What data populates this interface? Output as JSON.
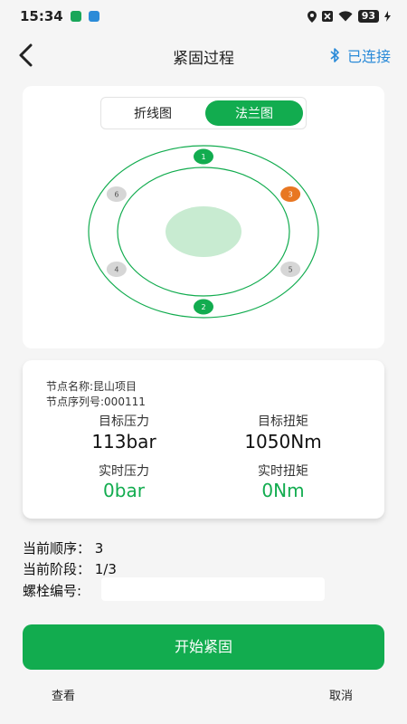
{
  "status_bar": {
    "time": "15:34",
    "battery": "93"
  },
  "header": {
    "title": "紧固过程",
    "connection": "已连接"
  },
  "tabs": [
    {
      "label": "折线图",
      "active": false
    },
    {
      "label": "法兰图",
      "active": true
    }
  ],
  "flange": {
    "bolts": [
      {
        "label": "1",
        "state": "done"
      },
      {
        "label": "3",
        "state": "current"
      },
      {
        "label": "5",
        "state": "pending"
      },
      {
        "label": "2",
        "state": "done"
      },
      {
        "label": "4",
        "state": "pending"
      },
      {
        "label": "6",
        "state": "pending"
      }
    ],
    "colors": {
      "done": "#12ac4f",
      "current": "#e87722",
      "pending": "#d6d6d6",
      "ring": "#12ac4f",
      "center": "#c8ebd1"
    }
  },
  "info": {
    "node_name": "节点名称:昆山项目",
    "node_serial": "节点序列号:000111",
    "target_pressure_label": "目标压力",
    "target_pressure_value": "113bar",
    "target_torque_label": "目标扭矩",
    "target_torque_value": "1050Nm",
    "live_pressure_label": "实时压力",
    "live_pressure_value": "0bar",
    "live_torque_label": "实时扭矩",
    "live_torque_value": "0Nm"
  },
  "progress": {
    "current_order": "当前顺序： 3",
    "current_stage": "当前阶段： 1/3",
    "bolt_number_label": "螺栓编号:",
    "bolt_number_value": ""
  },
  "actions": {
    "start": "开始紧固",
    "view": "查看",
    "cancel": "取消"
  },
  "accent_color": "#12ac4f",
  "link_color": "#2b8bd8"
}
